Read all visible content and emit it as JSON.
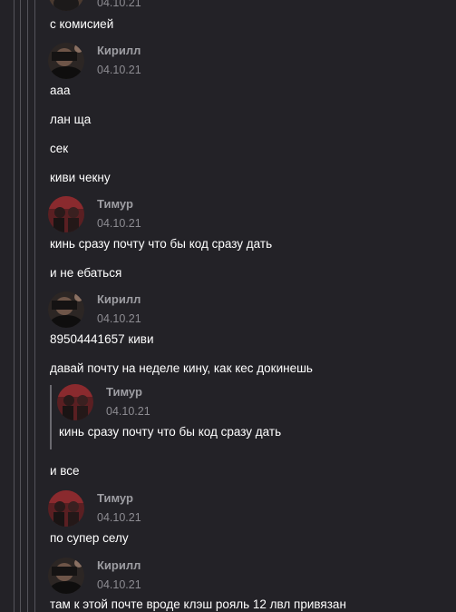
{
  "messages": [
    {
      "text": "с комисией"
    },
    {
      "author": "Кирилл",
      "date": "04.10.21"
    },
    {
      "text": "ааа"
    },
    {
      "text": "лан ща"
    },
    {
      "text": "сек"
    },
    {
      "text": "киви чекну"
    },
    {
      "author": "Тимур",
      "date": "04.10.21"
    },
    {
      "text": "кинь сразу почту что бы код сразу дать"
    },
    {
      "text": "и не ебаться"
    },
    {
      "author": "Кирилл",
      "date": "04.10.21"
    },
    {
      "text": "89504441657 киви"
    },
    {
      "text": "давай почту на неделе кину, как кес докинешь"
    },
    {
      "author": "Тимур",
      "date": "04.10.21",
      "text": "кинь сразу почту что бы код сразу дать"
    },
    {
      "text": "и все"
    },
    {
      "author": "Тимур",
      "date": "04.10.21"
    },
    {
      "text": "по супер селу"
    },
    {
      "author": "Кирилл",
      "date": "04.10.21"
    },
    {
      "text": "там к этой почте вроде клэш рояль 12 лвл привязан"
    }
  ],
  "top_partial": {
    "date": "04.10.21"
  }
}
